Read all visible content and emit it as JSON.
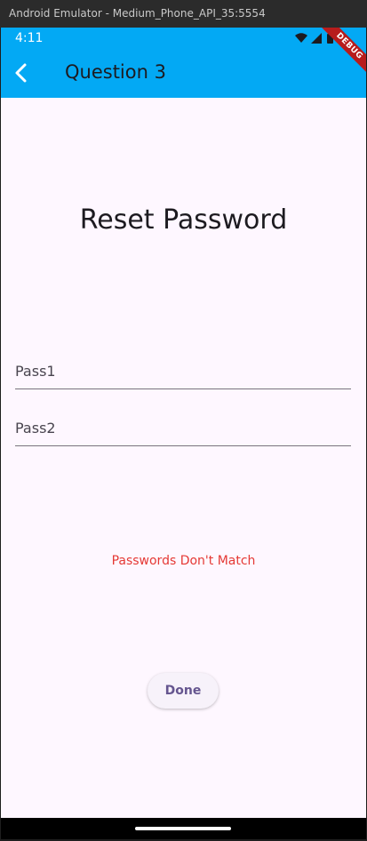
{
  "window": {
    "title": "Android Emulator - Medium_Phone_API_35:5554"
  },
  "status_bar": {
    "time": "4:11"
  },
  "app_bar": {
    "title": "Question 3",
    "accent_color": "#03a9f4"
  },
  "debug_banner": {
    "label": "DEBUG"
  },
  "page": {
    "heading": "Reset Password",
    "field1": {
      "placeholder": "Pass1",
      "value": ""
    },
    "field2": {
      "placeholder": "Pass2",
      "value": ""
    },
    "error_message": "Passwords Don't Match",
    "error_color": "#e53935",
    "done_label": "Done"
  },
  "icons": {
    "back": "chevron-left-icon",
    "wifi": "wifi-icon",
    "signal": "cell-signal-icon",
    "battery": "battery-icon"
  }
}
